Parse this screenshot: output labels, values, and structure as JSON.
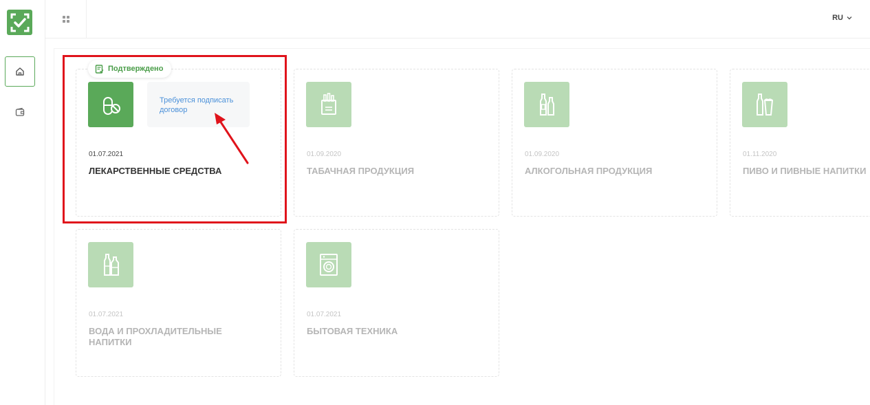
{
  "topbar": {
    "lang": "RU"
  },
  "badge": {
    "label": "Подтверждено"
  },
  "hint": {
    "text": "Требуется подписать договор"
  },
  "accent_color": "#5aa959",
  "highlight_color": "#e0131b",
  "link_color": "#4a90d9",
  "cards": [
    {
      "date": "01.07.2021",
      "title": "ЛЕКАРСТВЕННЫЕ СРЕДСТВА",
      "icon": "pill-icon"
    },
    {
      "date": "01.09.2020",
      "title": "ТАБАЧНАЯ ПРОДУКЦИЯ",
      "icon": "cigarette-pack-icon"
    },
    {
      "date": "01.09.2020",
      "title": "АЛКОГОЛЬНАЯ ПРОДУКЦИЯ",
      "icon": "bottles-icon"
    },
    {
      "date": "01.11.2020",
      "title": "ПИВО И ПИВНЫЕ НАПИТКИ",
      "icon": "beer-icon"
    },
    {
      "date": "01.07.2021",
      "title": "ВОДА И ПРОХЛАДИТЕЛЬНЫЕ НАПИТКИ",
      "icon": "water-bottles-icon"
    },
    {
      "date": "01.07.2021",
      "title": "БЫТОВАЯ ТЕХНИКА",
      "icon": "washing-machine-icon"
    }
  ]
}
